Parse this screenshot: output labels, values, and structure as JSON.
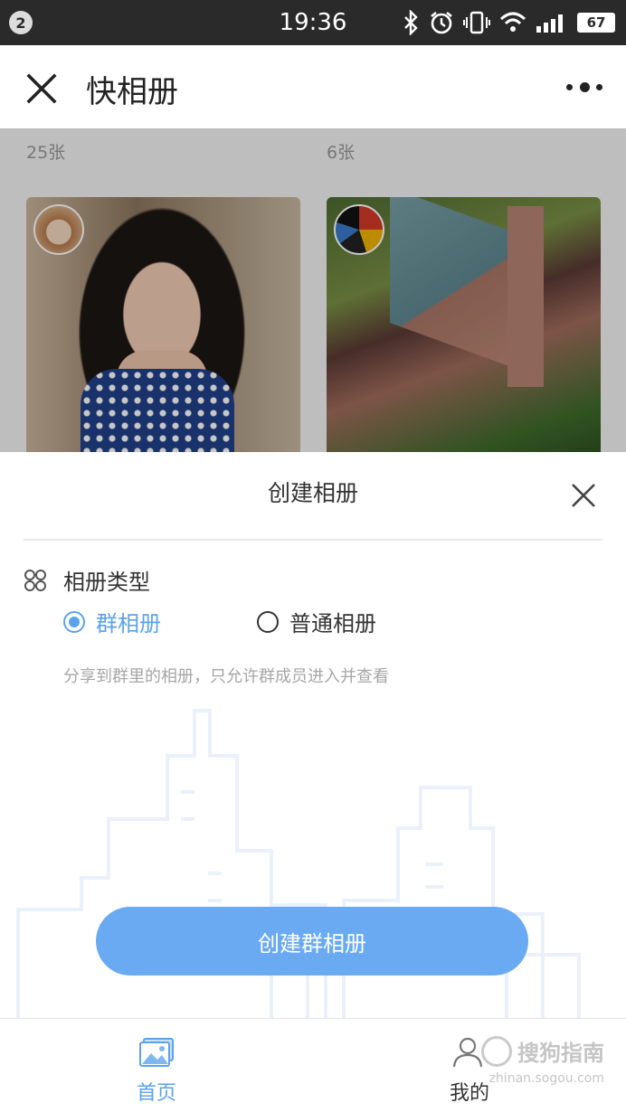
{
  "status_bar": {
    "notification_count": "2",
    "time": "19:36",
    "battery": "67",
    "icons": [
      "bluetooth-icon",
      "alarm-icon",
      "vibrate-icon",
      "wifi-icon",
      "signal-icon",
      "battery-icon"
    ]
  },
  "header": {
    "title": "快相册",
    "close_icon": "close-icon",
    "more_icon": "more-icon"
  },
  "albums": [
    {
      "count": "25张"
    },
    {
      "count": "6张"
    }
  ],
  "sheet": {
    "title": "创建相册",
    "type_label": "相册类型",
    "options": [
      {
        "label": "群相册",
        "selected": true
      },
      {
        "label": "普通相册",
        "selected": false
      }
    ],
    "hint": "分享到群里的相册，只允许群成员进入并查看",
    "create_button": "创建群相册"
  },
  "tabbar": {
    "home": "首页",
    "mine": "我的"
  },
  "watermark": {
    "brand": "搜狗指南",
    "url": "zhinan.sogou.com"
  },
  "colors": {
    "accent": "#5aa3ea",
    "button": "#6aaaf2",
    "status_bar": "#2a2a2a"
  }
}
